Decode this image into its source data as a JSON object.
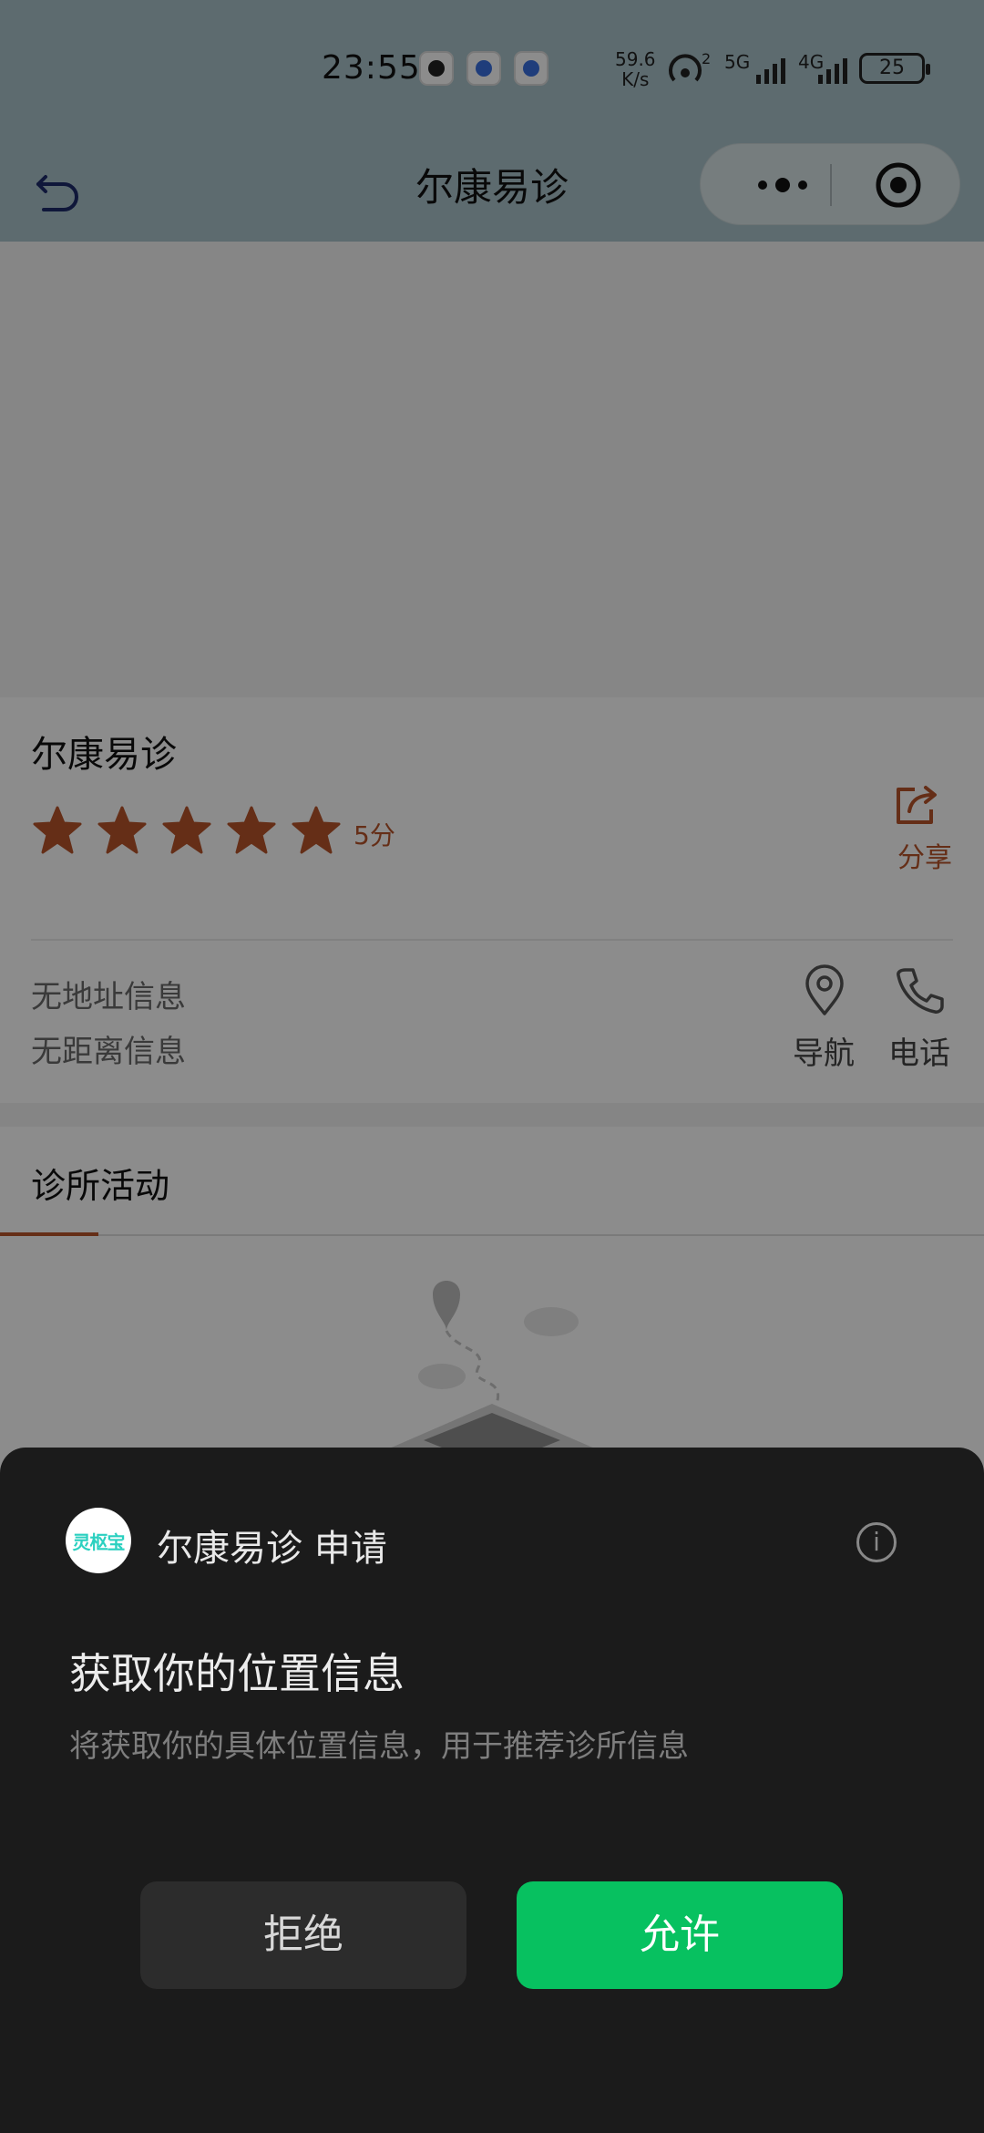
{
  "status_bar": {
    "time": "23:55",
    "net_speed_value": "59.6",
    "net_speed_unit": "K/s",
    "hotspot_badge": "2",
    "signal1_label": "5G",
    "signal2_label": "4G",
    "battery": "25"
  },
  "navbar": {
    "title": "尔康易诊"
  },
  "clinic": {
    "name": "尔康易诊",
    "rating_stars": 5,
    "score_label": "5分",
    "share_label": "分享",
    "address": "无地址信息",
    "distance": "无距离信息",
    "navigate_label": "导航",
    "phone_label": "电话"
  },
  "tabs": {
    "active_label": "诊所活动"
  },
  "permission_sheet": {
    "app_logo_text": "灵枢宝",
    "app_request": "尔康易诊  申请",
    "title": "获取你的位置信息",
    "description": "将获取你的具体位置信息，用于推荐诊所信息",
    "reject_label": "拒绝",
    "allow_label": "允许"
  },
  "colors": {
    "accent": "#b8542a",
    "allow_green": "#07c160",
    "sheet_bg": "#1b1b1b"
  }
}
